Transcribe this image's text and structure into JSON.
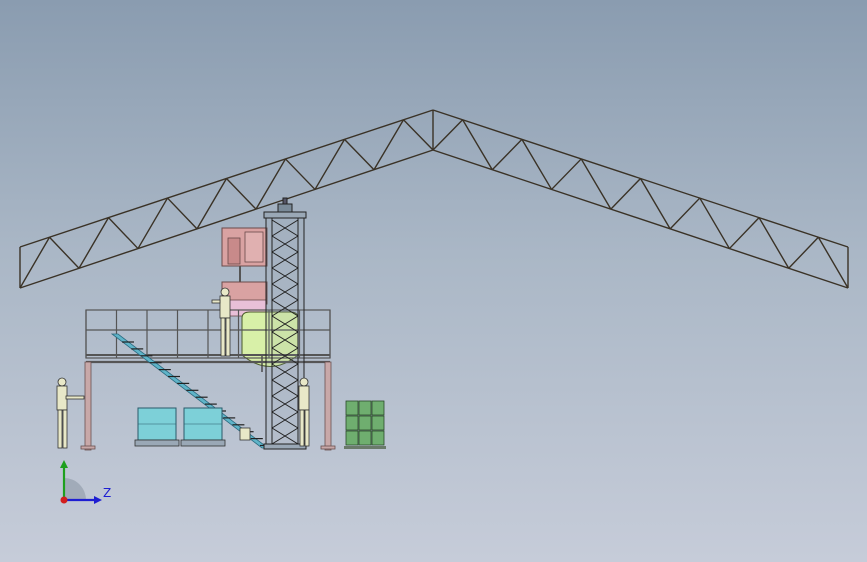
{
  "axis_triad": {
    "z_label": "Z"
  },
  "colors": {
    "background_top": "#8a9cb0",
    "background_bottom": "#c6ccd9",
    "truss": "#3a3226",
    "platform_frame": "#555555",
    "columns": "#c8a8a8",
    "stair": "#5fb4c8",
    "tank": "#d8f0a8",
    "mixer": "#d9a2a2",
    "pallet_totes": "#7dd0d8",
    "crates": "#6fae6f",
    "worker": "#e8e8c8",
    "axis_x": "#1e1ed2",
    "axis_y": "#1ea01e",
    "axis_origin": "#d21e1e"
  }
}
